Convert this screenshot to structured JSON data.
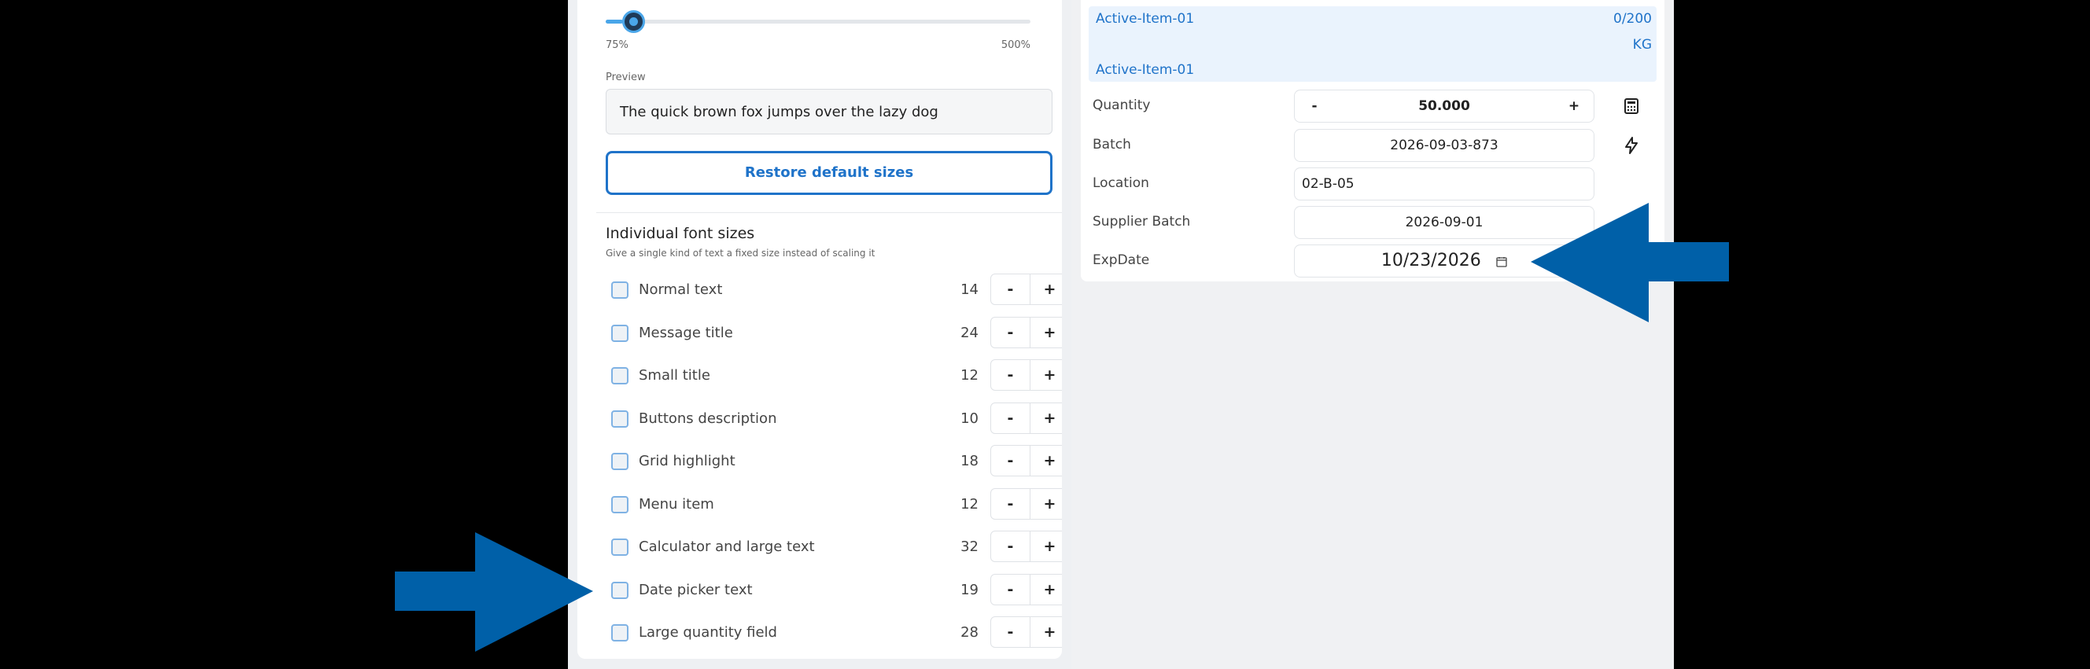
{
  "font_settings": {
    "scale_slider": {
      "min_label": "75%",
      "max_label": "500%",
      "value_fraction": 0.04
    },
    "preview": {
      "label": "Preview",
      "text": "The quick brown fox jumps over the lazy dog"
    },
    "restore_button_label": "Restore default sizes",
    "individual": {
      "title": "Individual font sizes",
      "subtitle": "Give a single kind of text a fixed size instead of scaling it",
      "rows": [
        {
          "label": "Normal text",
          "value": "14"
        },
        {
          "label": "Message title",
          "value": "24"
        },
        {
          "label": "Small title",
          "value": "12"
        },
        {
          "label": "Buttons description",
          "value": "10"
        },
        {
          "label": "Grid highlight",
          "value": "18"
        },
        {
          "label": "Menu item",
          "value": "12"
        },
        {
          "label": "Calculator and large text",
          "value": "32"
        },
        {
          "label": "Date picker text",
          "value": "19"
        },
        {
          "label": "Large quantity field",
          "value": "28"
        }
      ],
      "minus_label": "-",
      "plus_label": "+"
    }
  },
  "item_form": {
    "active_item": {
      "name": "Active-Item-01",
      "count": "0/200",
      "unit": "KG",
      "name_repeat": "Active-Item-01"
    },
    "quantity": {
      "label": "Quantity",
      "value": "50.000",
      "minus": "-",
      "plus": "+"
    },
    "batch": {
      "label": "Batch",
      "value": "2026-09-03-873"
    },
    "location": {
      "label": "Location",
      "value": "02-B-05"
    },
    "supplier_batch": {
      "label": "Supplier Batch",
      "value": "2026-09-01"
    },
    "exp_date": {
      "label": "ExpDate",
      "value": "10/23/2026"
    }
  },
  "colors": {
    "accent": "#1f73c9",
    "arrow": "#0060a8",
    "background": "#000000"
  }
}
